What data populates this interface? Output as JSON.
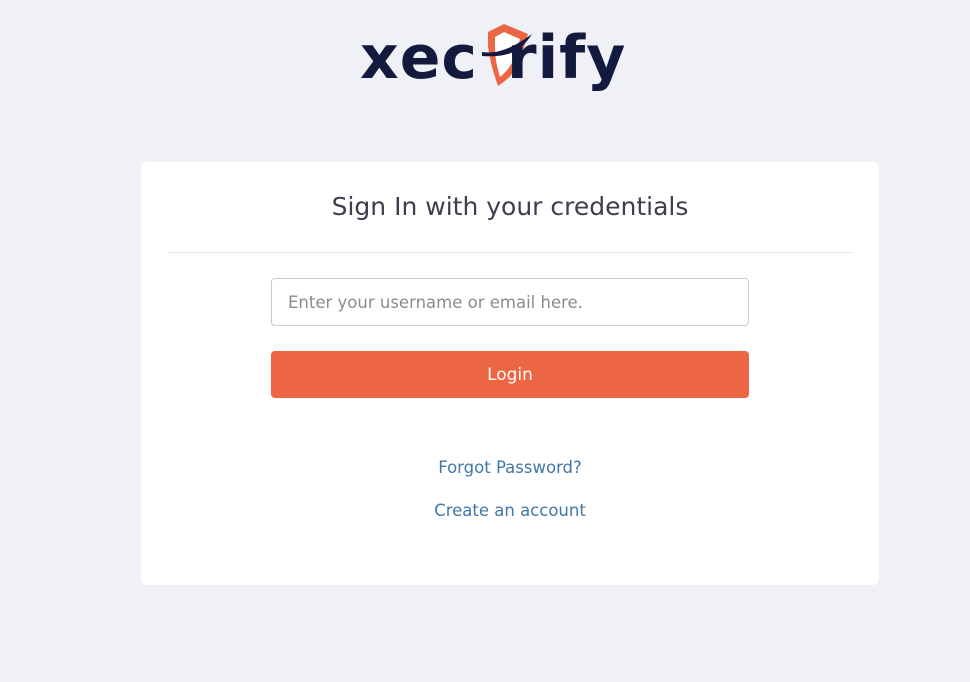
{
  "logo": {
    "text_before_mark": "xec",
    "text_after_mark": "rify",
    "mark_icon": "shield-icon"
  },
  "colors": {
    "page_background": "#f0f0f7",
    "card_background": "#ffffff",
    "brand_navy": "#141a3e",
    "brand_orange": "#ec6643",
    "link": "#3f78a8"
  },
  "login_card": {
    "title": "Sign In with your credentials",
    "username_input": {
      "value": "",
      "placeholder": "Enter your username or email here."
    },
    "login_button_label": "Login",
    "forgot_password_link": "Forgot Password?",
    "create_account_link": "Create an account"
  }
}
